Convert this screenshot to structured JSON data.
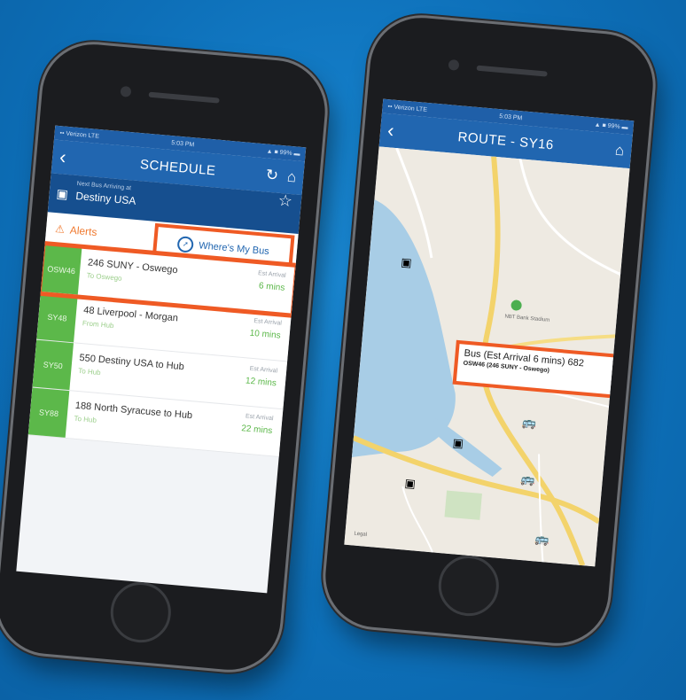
{
  "left_phone": {
    "status": {
      "carrier": "•• Verizon LTE",
      "time": "5:03 PM",
      "battery": "▲ ■ 99% ▬"
    },
    "header": {
      "back": "‹",
      "title": "SCHEDULE",
      "refresh_icon": "↻",
      "home_icon": "⌂"
    },
    "next_bus": {
      "label": "Next Bus Arriving at",
      "stop": "Destiny USA",
      "star_icon": "☆"
    },
    "alerts": {
      "icon": "⚠",
      "label": "Alerts"
    },
    "wheres_my_bus": {
      "icon": "➚",
      "label": "Where's My Bus"
    },
    "routes": [
      {
        "code": "OSW46",
        "name": "246 SUNY - Oswego",
        "dir": "To Oswego",
        "eta_label": "Est Arrival",
        "eta": "6 mins"
      },
      {
        "code": "SY48",
        "name": "48 Liverpool - Morgan",
        "dir": "From Hub",
        "eta_label": "Est Arrival",
        "eta": "10 mins"
      },
      {
        "code": "SY50",
        "name": "550 Destiny USA to Hub",
        "dir": "To Hub",
        "eta_label": "Est Arrival",
        "eta": "12 mins"
      },
      {
        "code": "SY88",
        "name": "188 North Syracuse to Hub",
        "dir": "To Hub",
        "eta_label": "Est Arrival",
        "eta": "22 mins"
      }
    ]
  },
  "right_phone": {
    "status": {
      "carrier": "•• Verizon LTE",
      "time": "5:03 PM",
      "battery": "▲ ■ 99% ▬"
    },
    "header": {
      "back": "‹",
      "title": "ROUTE - SY16",
      "home_icon": "⌂"
    },
    "callout": {
      "line1": "Bus (Est Arrival 6 mins) 682",
      "line2": "OSW46 (246 SUNY - Oswego)"
    },
    "map_labels": {
      "stadium": "NBT Bank Stadium",
      "legal": "Legal"
    }
  },
  "colors": {
    "accent": "#ef5a24",
    "header": "#2166b0",
    "route_green": "#5cb84a",
    "background": "#0f78c4"
  }
}
